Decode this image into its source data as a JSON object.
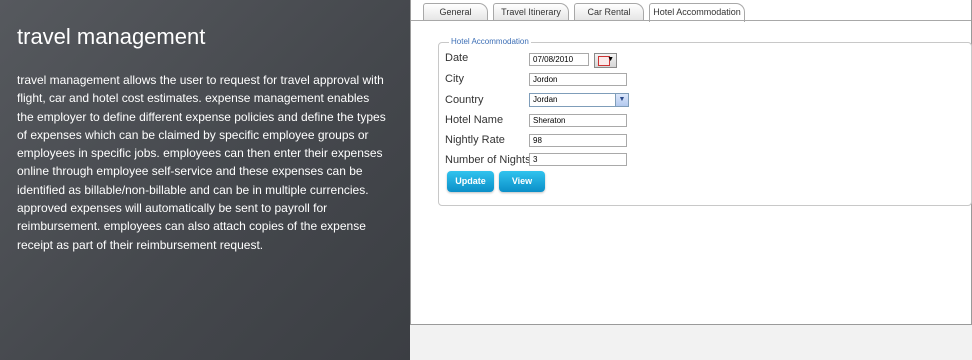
{
  "left": {
    "title": "travel management",
    "paragraph": "travel management allows the user to request for travel approval with flight, car and hotel cost estimates.   expense management enables the employer to define different expense policies and define the types of expenses which can be claimed by specific employee groups or employees in specific jobs. employees can then enter their expenses online through employee self-service and these expenses can be identified as billable/non-billable and can be in multiple currencies. approved expenses will automatically be sent to payroll for reimbursement.   employees can also attach copies of the expense receipt as part of their reimbursement request."
  },
  "tabs": [
    {
      "label": "General"
    },
    {
      "label": "Travel Itinerary"
    },
    {
      "label": "Car Rental"
    },
    {
      "label": "Hotel Accommodation",
      "active": true
    }
  ],
  "form": {
    "legend": "Hotel Accommodation",
    "date_label": "Date",
    "date_value": "07/08/2010",
    "city_label": "City",
    "city_value": "Jordon",
    "country_label": "Country",
    "country_value": "Jordan",
    "hotel_label": "Hotel Name",
    "hotel_value": "Sheraton",
    "rate_label": "Nightly Rate",
    "rate_value": "98",
    "nights_label": "Number of Nights",
    "nights_value": "3"
  },
  "buttons": {
    "update": "Update",
    "view": "View"
  },
  "icons": {
    "calendar": "calendar-icon",
    "dropdown": "chevron-down-icon"
  },
  "colors": {
    "legend": "#3d6fb6",
    "button": "#18a7dc",
    "left_panel": "#4a4d52"
  }
}
